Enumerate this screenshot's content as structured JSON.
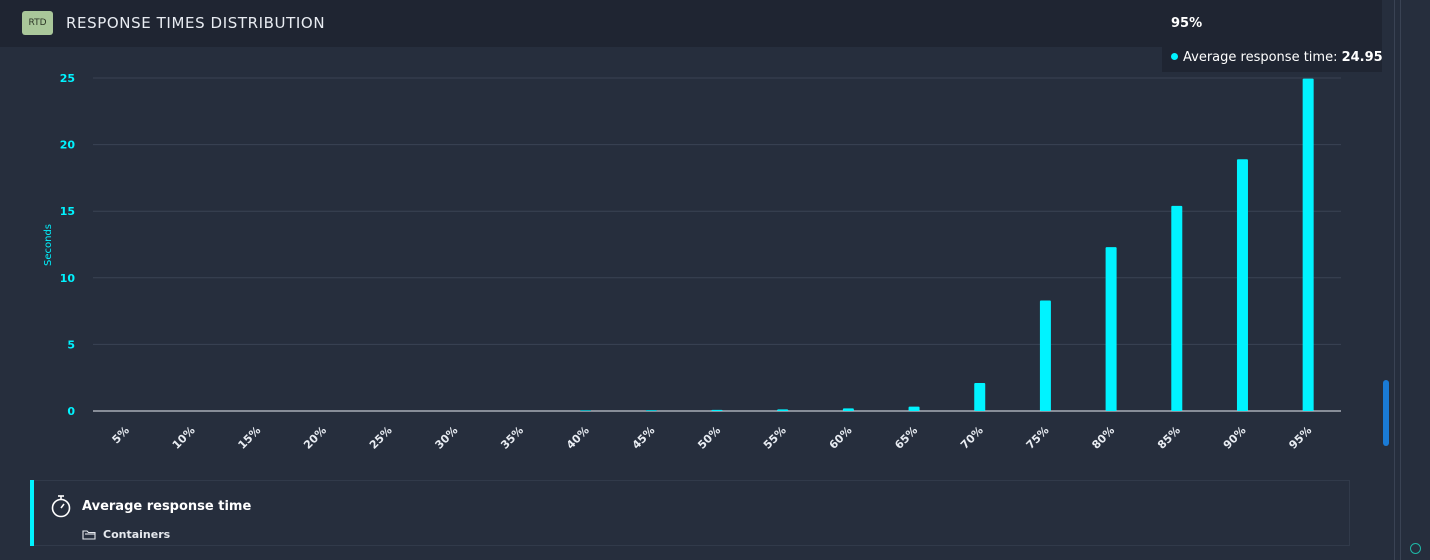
{
  "header": {
    "badge": "RTD",
    "title": "RESPONSE TIMES DISTRIBUTION"
  },
  "tooltip": {
    "title": "95%",
    "series_label": "Average response time:",
    "value": "24.957 sec"
  },
  "footer": {
    "metric": "Average response time",
    "entity": "Containers"
  },
  "colors": {
    "bar": "#00f3ff",
    "axis_label": "#00f3ff",
    "grid": "#3a4354",
    "background": "#262e3d",
    "header": "#1f2532"
  },
  "icons": {
    "footer_metric": "stopwatch-icon",
    "footer_entity": "folder-icon",
    "corner": "chevron-circle-icon"
  },
  "chart_data": {
    "type": "bar",
    "categories": [
      "5%",
      "10%",
      "15%",
      "20%",
      "25%",
      "30%",
      "35%",
      "40%",
      "45%",
      "50%",
      "55%",
      "60%",
      "65%",
      "70%",
      "75%",
      "80%",
      "85%",
      "90%",
      "95%"
    ],
    "values": [
      0,
      0,
      0,
      0,
      0,
      0,
      0,
      0.05,
      0.06,
      0.08,
      0.12,
      0.2,
      0.33,
      2.1,
      8.3,
      12.3,
      15.4,
      18.9,
      24.957
    ],
    "title": "",
    "xlabel": "",
    "ylabel": "Seconds",
    "ylim": [
      0,
      25
    ],
    "yticks": [
      0,
      5,
      10,
      15,
      20,
      25
    ],
    "grid": true,
    "legend": "none"
  }
}
